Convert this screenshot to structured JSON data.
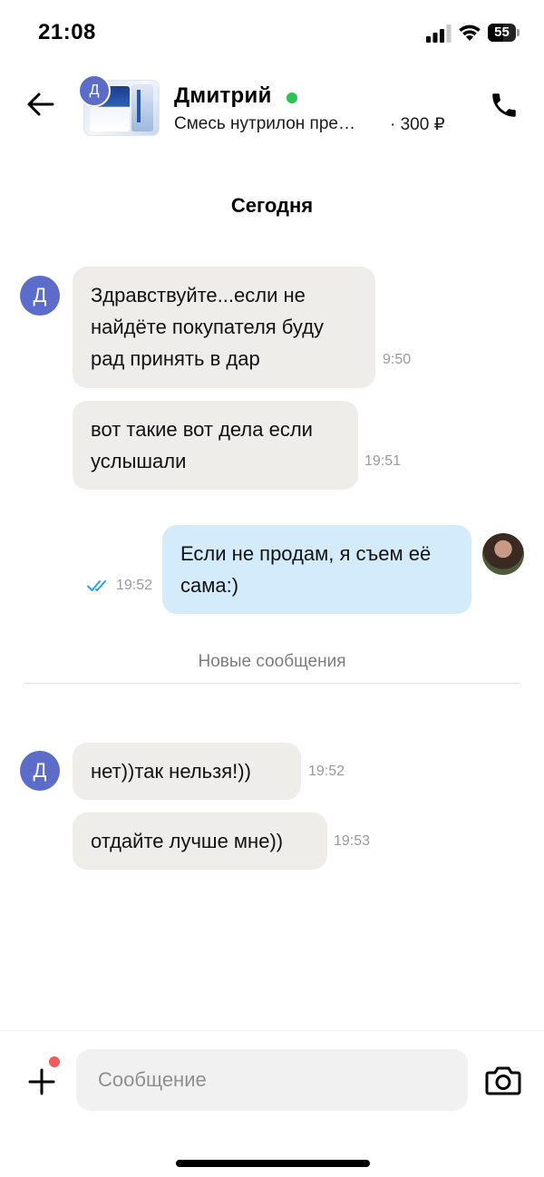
{
  "status_bar": {
    "time": "21:08",
    "battery_level": "55"
  },
  "header": {
    "contact_name": "Дмитрий",
    "contact_initial": "Д",
    "online": true,
    "product_title": "Смесь нутрилон пре…",
    "product_price": "· 300 ₽"
  },
  "chat": {
    "date_divider": "Сегодня",
    "new_messages_label": "Новые сообщения",
    "messages": [
      {
        "from": "them",
        "avatar_initial": "Д",
        "text": "Здравствуйте...если не найдёте покупателя буду рад принять в дар",
        "time": "9:50"
      },
      {
        "from": "them",
        "text": "вот такие вот дела если услышали",
        "time": "19:51"
      },
      {
        "from": "me",
        "text": "Если не продам, я съем её сама:)",
        "time": "19:52",
        "read": true
      },
      {
        "from": "them",
        "avatar_initial": "Д",
        "text": "нет))так нельзя!))",
        "time": "19:52"
      },
      {
        "from": "them",
        "text": "отдайте лучше мне))",
        "time": "19:53"
      }
    ]
  },
  "composer": {
    "placeholder": "Сообщение"
  },
  "colors": {
    "incoming_bubble": "#efedea",
    "outgoing_bubble": "#d4ebfb",
    "avatar": "#5b6cc9",
    "online": "#2cc24f",
    "notification_dot": "#f55a5a",
    "read_check": "#2b9df0"
  },
  "icons": [
    "signal-icon",
    "wifi-icon",
    "battery-icon",
    "back-arrow-icon",
    "phone-icon",
    "double-check-icon",
    "plus-icon",
    "camera-icon"
  ]
}
